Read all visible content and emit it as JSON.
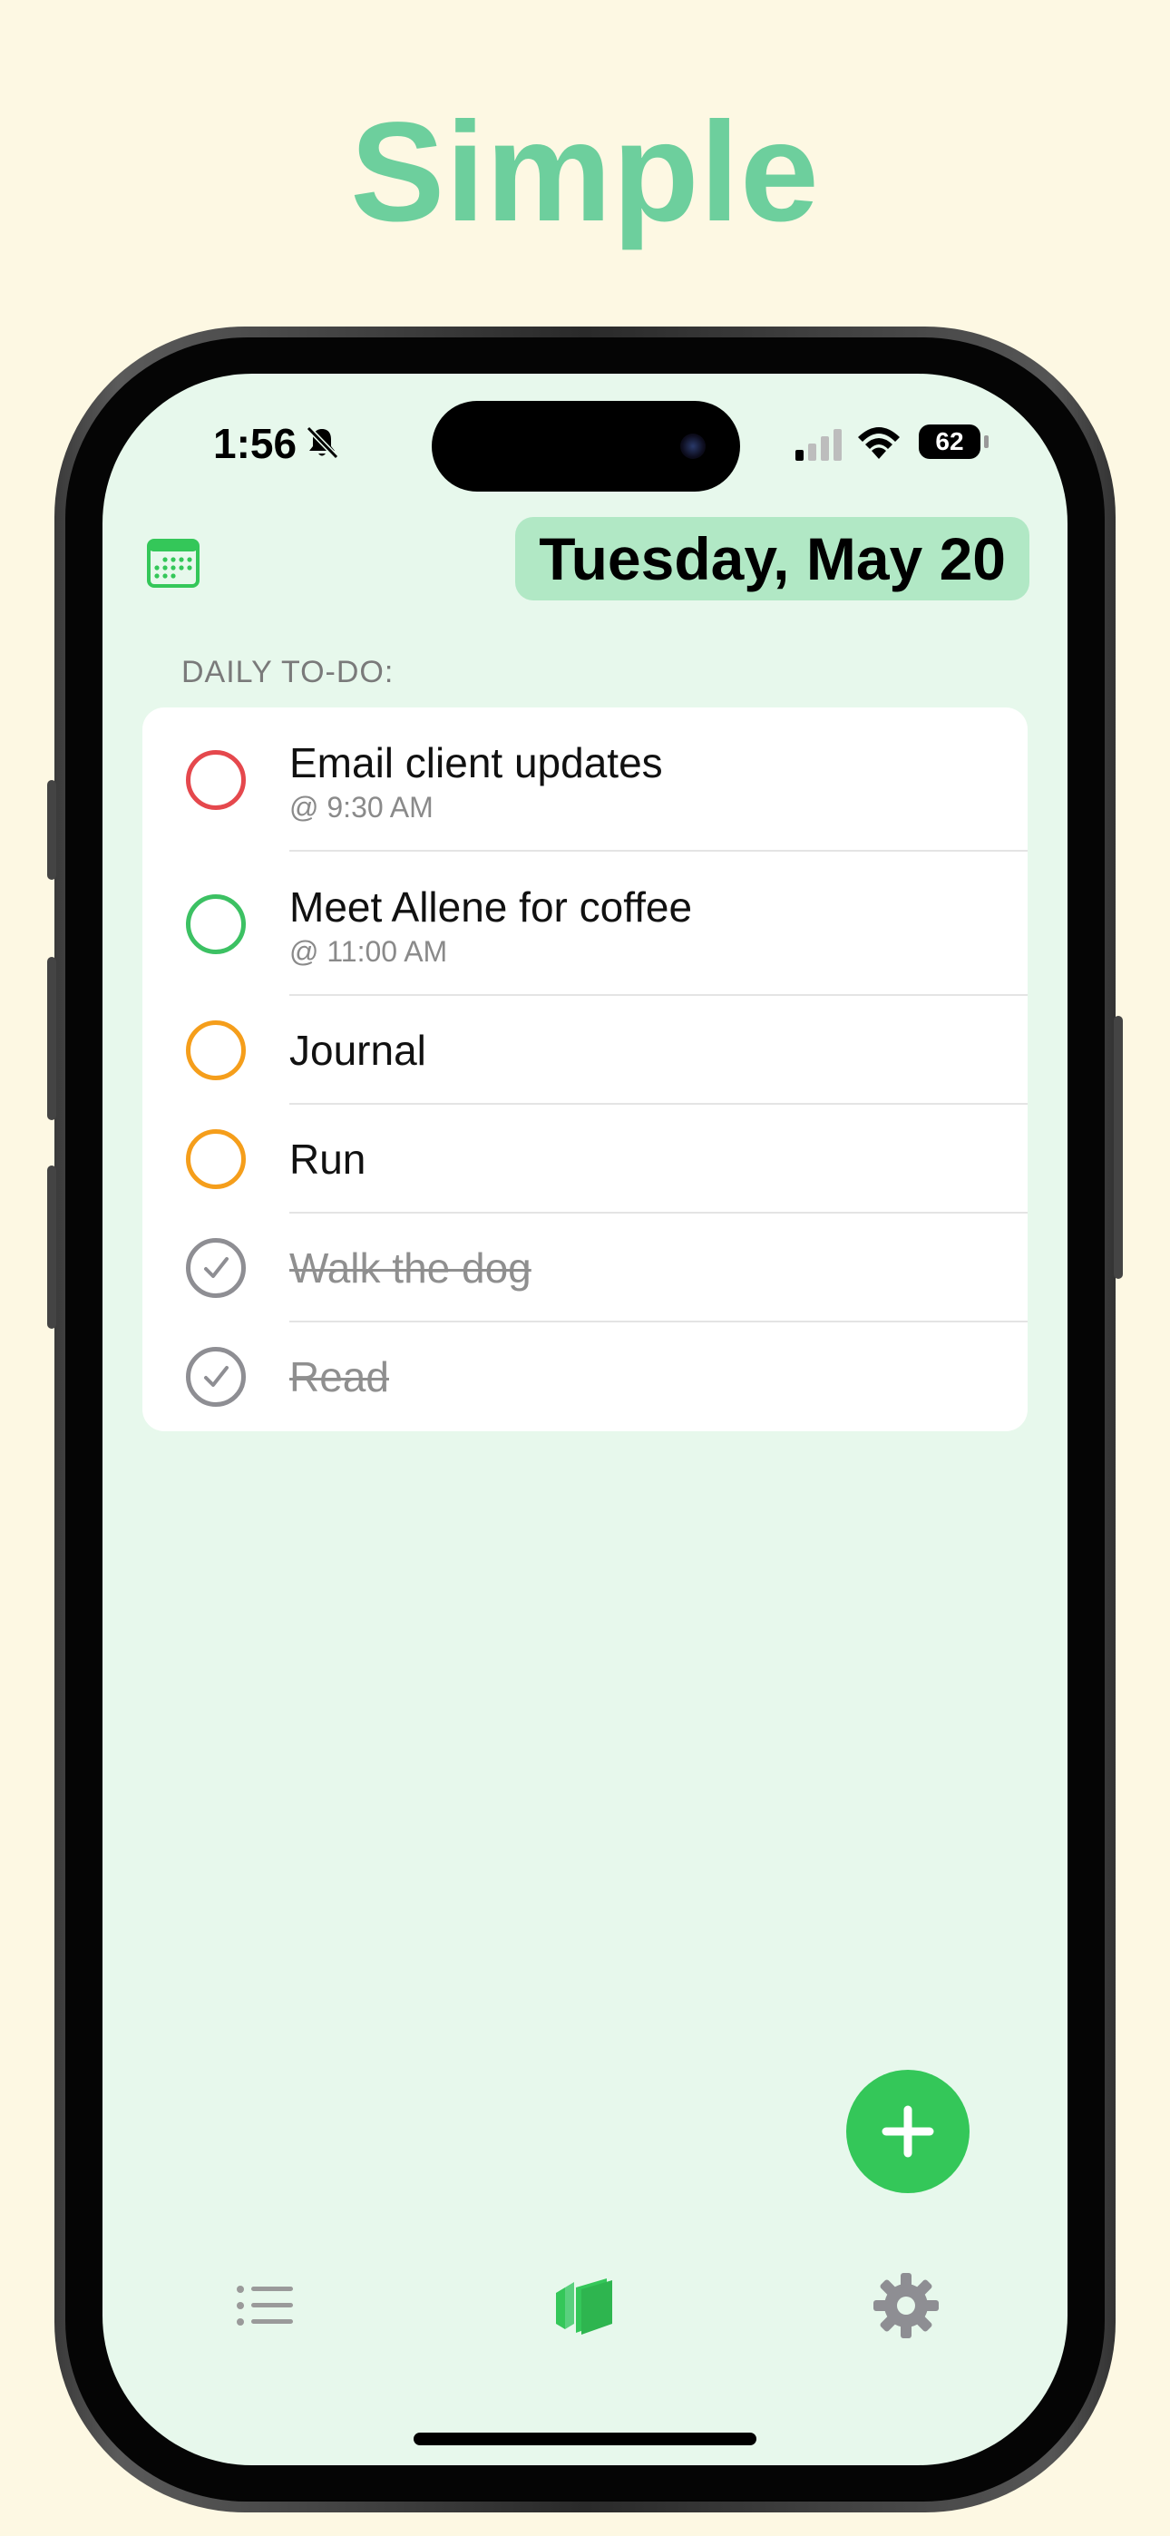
{
  "headline": "Simple",
  "status_bar": {
    "time": "1:56",
    "battery": "62",
    "icons": [
      "bell-slash-icon",
      "cellular-signal-icon",
      "wifi-icon",
      "battery-icon"
    ]
  },
  "header": {
    "calendar_icon": "calendar-icon",
    "date": "Tuesday, May 20"
  },
  "section_label": "DAILY TO-DO:",
  "tasks": [
    {
      "title": "Email client updates",
      "time": "@ 9:30 AM",
      "color": "#e5484d",
      "done": false
    },
    {
      "title": "Meet Allene for coffee",
      "time": "@ 11:00 AM",
      "color": "#3cc163",
      "done": false
    },
    {
      "title": "Journal",
      "time": "",
      "color": "#f59e1b",
      "done": false
    },
    {
      "title": "Run",
      "time": "",
      "color": "#f59e1b",
      "done": false
    },
    {
      "title": "Walk the dog",
      "time": "",
      "color": "#8e8e93",
      "done": true
    },
    {
      "title": "Read",
      "time": "",
      "color": "#8e8e93",
      "done": true
    }
  ],
  "fab_icon": "plus-icon",
  "tab_bar": {
    "items": [
      {
        "icon": "list-icon",
        "active": false
      },
      {
        "icon": "cards-icon",
        "active": true
      },
      {
        "icon": "gear-icon",
        "active": false
      }
    ]
  },
  "colors": {
    "accent": "#34c759",
    "background": "#fdf8e3",
    "screen": "#e7f8ec",
    "date_pill": "#b1e8c5",
    "headline": "#6dcf9d"
  }
}
